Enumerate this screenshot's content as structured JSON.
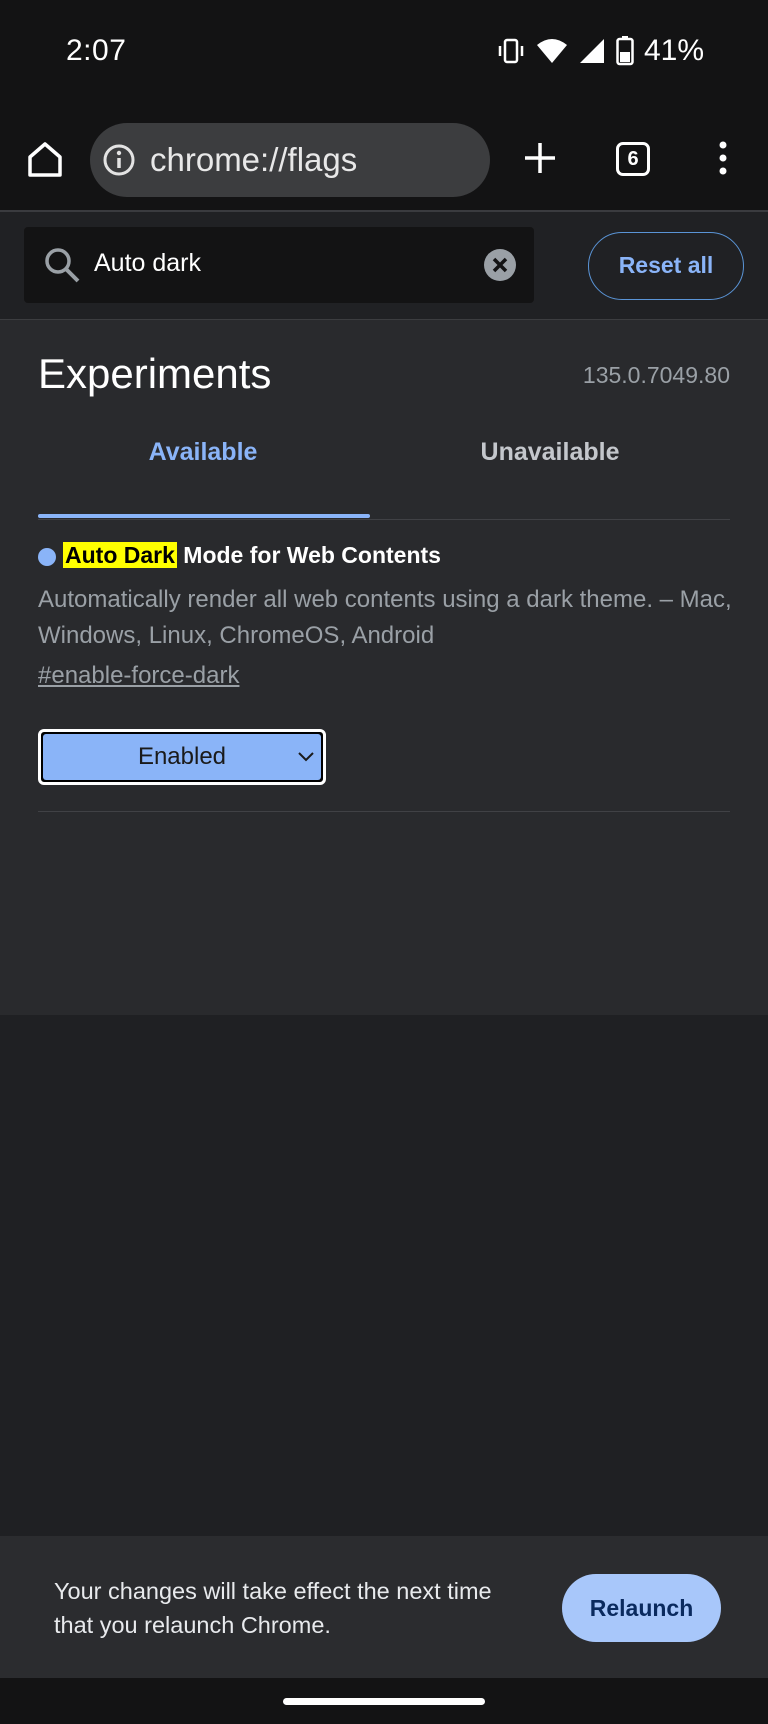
{
  "status_bar": {
    "time": "2:07",
    "battery_percent": "41%",
    "icons": [
      "vibrate-icon",
      "wifi-icon",
      "signal-icon",
      "battery-icon"
    ]
  },
  "toolbar": {
    "url": "chrome://flags",
    "tab_count": "6",
    "icons": [
      "home-icon",
      "info-icon",
      "plus-icon",
      "tabs-icon",
      "more-vert-icon"
    ]
  },
  "search": {
    "value": "Auto dark",
    "reset_label": "Reset all"
  },
  "page": {
    "title": "Experiments",
    "version": "135.0.7049.80",
    "tabs": [
      {
        "label": "Available",
        "selected": true
      },
      {
        "label": "Unavailable",
        "selected": false
      }
    ]
  },
  "flag": {
    "title_highlight": "Auto Dark",
    "title_rest": " Mode for Web Contents",
    "description": "Automatically render all web contents using a dark theme. – Mac, Windows, Linux, ChromeOS, Android",
    "link": "#enable-force-dark",
    "selected_option": "Enabled"
  },
  "snackbar": {
    "message": "Your changes will take effect the next time that you relaunch Chrome.",
    "button_label": "Relaunch"
  },
  "colors": {
    "accent": "#8ab4f8",
    "highlight": "#ffff00",
    "background": "#292a2d"
  }
}
